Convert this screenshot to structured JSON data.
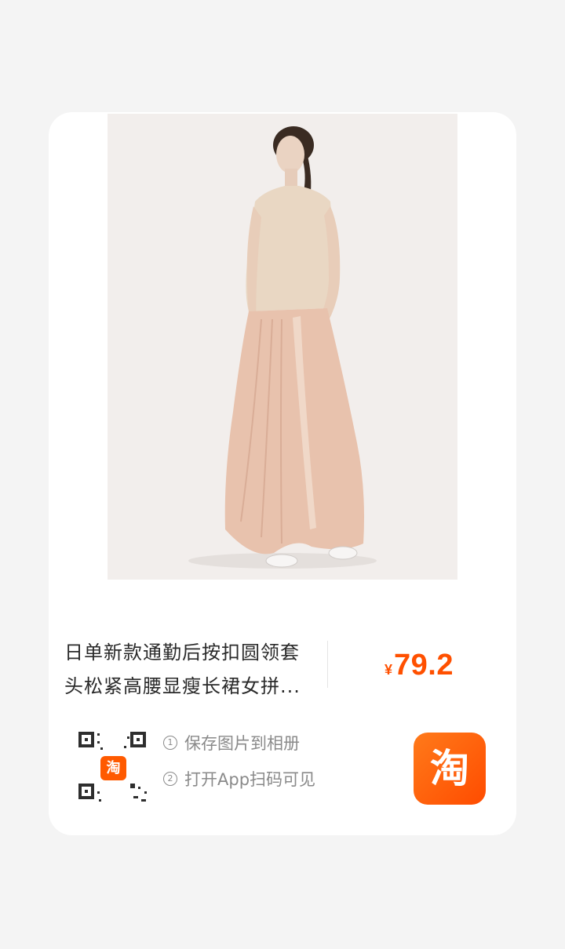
{
  "product": {
    "title_line1": "日单新款通勤后按扣圆领套",
    "title_line2": "头松紧高腰显瘦长裙女拼...",
    "currency": "¥",
    "price": "79.2"
  },
  "qr": {
    "logo_char": "淘"
  },
  "steps": [
    {
      "num": "1",
      "text": "保存图片到相册"
    },
    {
      "num": "2",
      "text": "打开App扫码可见"
    }
  ],
  "app_icon": {
    "char": "淘"
  },
  "colors": {
    "accent": "#ff5000",
    "background": "#f4f4f4",
    "card": "#ffffff"
  }
}
